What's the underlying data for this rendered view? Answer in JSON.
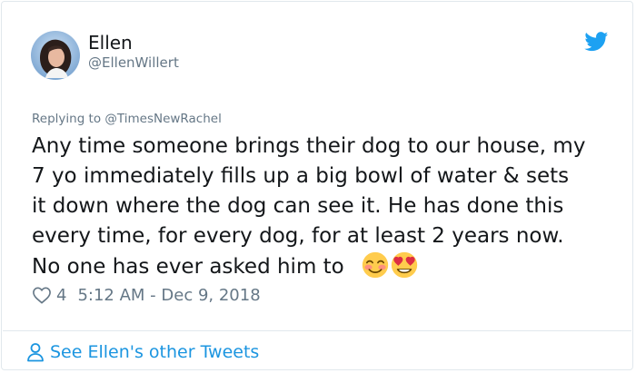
{
  "colors": {
    "accent": "#1b95e0",
    "muted": "#657786",
    "text": "#14171a",
    "border": "#e1e8ed"
  },
  "author": {
    "name": "Ellen",
    "handle": "@EllenWillert"
  },
  "reply": {
    "prefix": "Replying to ",
    "target": "@TimesNewRachel"
  },
  "tweet": {
    "lines": [
      "Any time someone brings their dog to our house, my",
      "7 yo immediately fills up a big bowl of water & sets",
      "it down where the dog can see it. He has done this",
      "every time, for every dog, for at least 2 years now.",
      "No one has ever asked him to"
    ],
    "emojis": [
      "smiling-face-with-smiling-eyes",
      "smiling-face-with-heart-eyes"
    ]
  },
  "meta": {
    "likes": "4",
    "time": "5:12 AM",
    "separator": " - ",
    "date": "Dec 9, 2018"
  },
  "footer": {
    "see_more": "See Ellen's other Tweets"
  },
  "icons": {
    "logo": "twitter-bird-icon",
    "like": "heart-icon",
    "profile": "person-icon"
  }
}
